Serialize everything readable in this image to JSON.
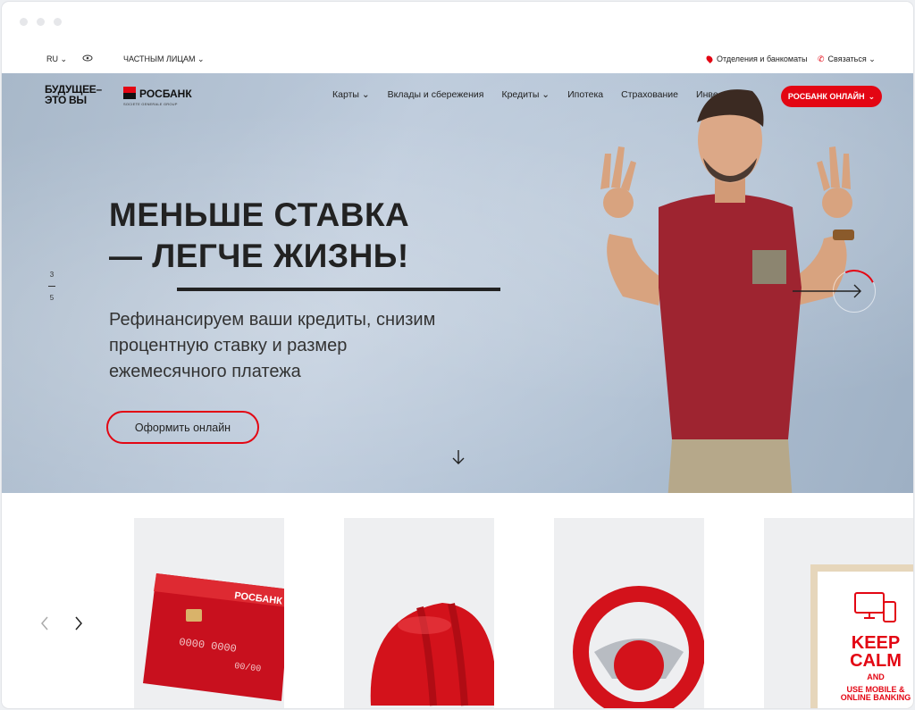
{
  "topbar": {
    "language": "RU",
    "segment": "ЧАСТНЫМ ЛИЦАМ",
    "branches": "Отделения и банкоматы",
    "contact": "Связаться"
  },
  "header": {
    "slogan_line1": "БУДУЩЕЕ–",
    "slogan_line2": "ЭТО ВЫ",
    "brand": "РОСБАНК",
    "brand_sub": "SOCIETE GENERALE GROUP",
    "nav": [
      {
        "label": "Карты",
        "has_dropdown": true
      },
      {
        "label": "Вклады и сбережения",
        "has_dropdown": false
      },
      {
        "label": "Кредиты",
        "has_dropdown": true
      },
      {
        "label": "Ипотека",
        "has_dropdown": false
      },
      {
        "label": "Страхование",
        "has_dropdown": false
      },
      {
        "label": "Инве",
        "has_dropdown": false
      }
    ],
    "online_button": "РОСБАНК ОНЛАЙН"
  },
  "hero": {
    "headline_line1": "МЕНЬШЕ СТАВКА",
    "headline_line2": "— ЛЕГЧЕ ЖИЗНЬ!",
    "subtext_line1": "Рефинансируем ваши кредиты, снизим",
    "subtext_line2": "процентную ставку и размер",
    "subtext_line3": "ежемесячного платежа",
    "cta": "Оформить онлайн",
    "slide_current": "3",
    "slide_total": "5"
  },
  "products": {
    "card1_brand": "РОСБАНК",
    "card1_number": "0000 0000",
    "card1_expiry": "00/00",
    "card4_line1": "KEEP",
    "card4_line2": "CALM",
    "card4_line3": "AND",
    "card4_line4": "USE MOBILE &",
    "card4_line5": "ONLINE BANKING"
  },
  "colors": {
    "accent": "#e30613",
    "text": "#222222"
  }
}
